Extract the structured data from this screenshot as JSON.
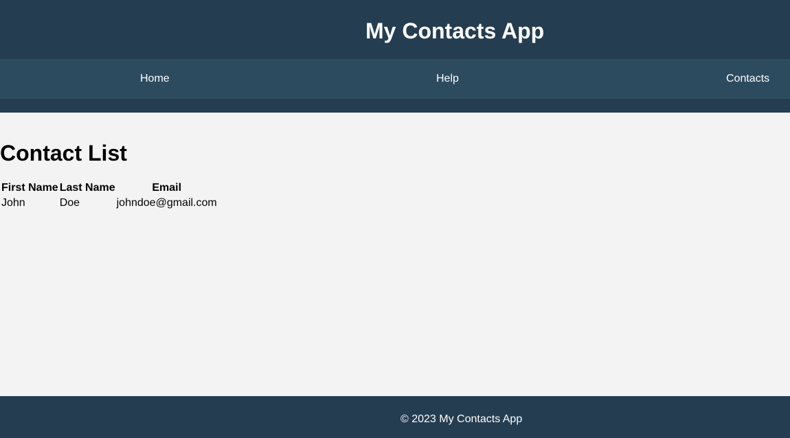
{
  "header": {
    "title": "My Contacts App"
  },
  "nav": {
    "items": [
      {
        "label": "Home"
      },
      {
        "label": "Help"
      },
      {
        "label": "Contacts"
      }
    ]
  },
  "main": {
    "title": "Contact List",
    "table": {
      "columns": [
        "First Name",
        "Last Name",
        "Email"
      ],
      "rows": [
        {
          "first_name": "John",
          "last_name": "Doe",
          "email": "johndoe@gmail.com"
        }
      ]
    }
  },
  "footer": {
    "text": "© 2023 My Contacts App"
  },
  "colors": {
    "header_bg": "#253d51",
    "nav_bg": "#2d4b5f",
    "page_bg": "#f3f3f3",
    "footer_bg": "#253d51"
  }
}
